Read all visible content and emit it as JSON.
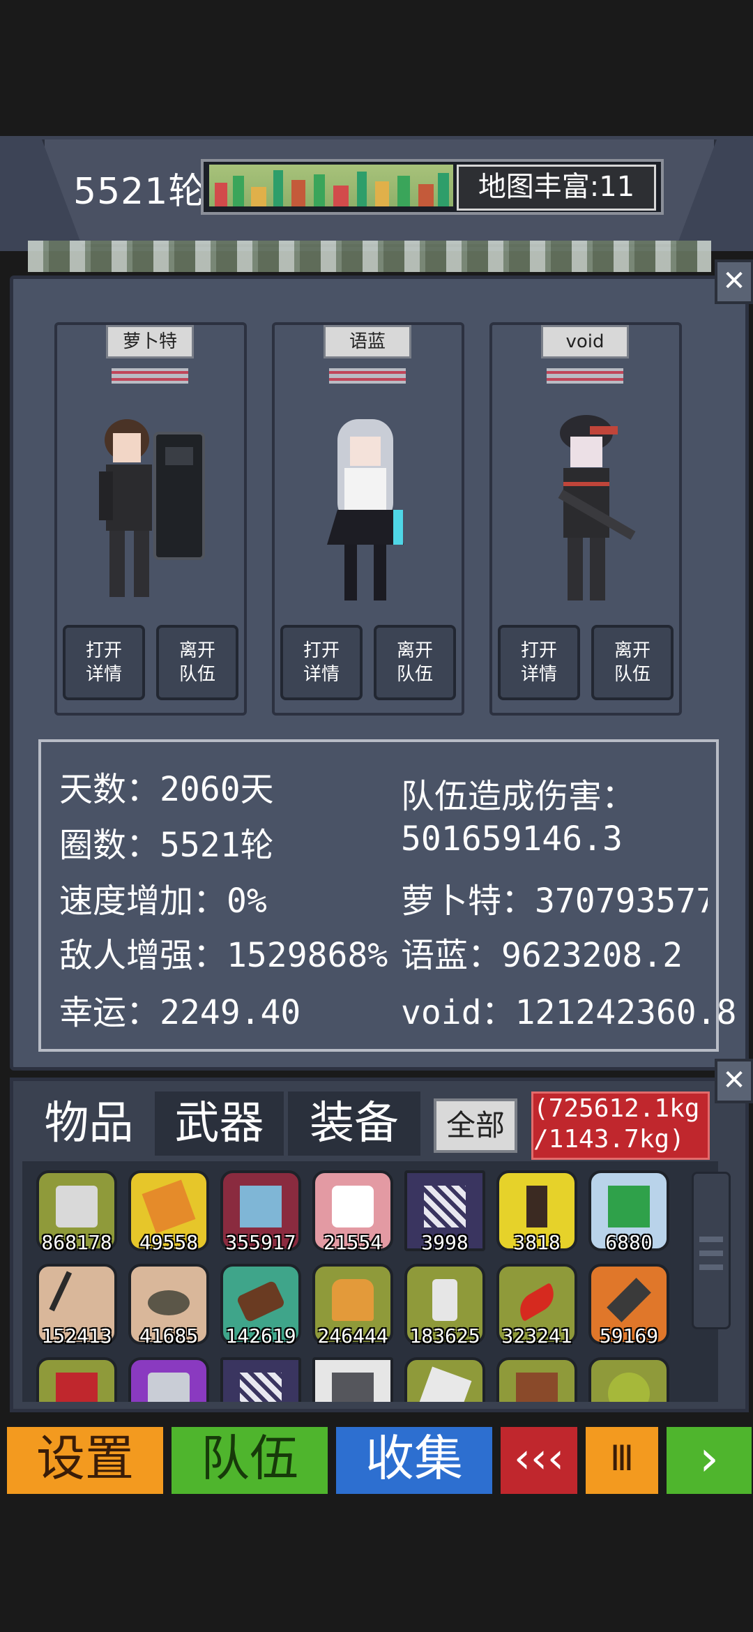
{
  "header": {
    "round": "5521轮",
    "map_richness": "地图丰富:11"
  },
  "team": {
    "members": [
      {
        "name": "萝卜特",
        "detail_btn": "打开\n详情",
        "leave_btn": "离开\n队伍"
      },
      {
        "name": "语蓝",
        "detail_btn": "打开\n详情",
        "leave_btn": "离开\n队伍"
      },
      {
        "name": "void",
        "detail_btn": "打开\n详情",
        "leave_btn": "离开\n队伍"
      }
    ],
    "close_label": "✕"
  },
  "stats": {
    "days": "天数：2060天",
    "loops": "圈数：5521轮",
    "speed": "速度增加：0%",
    "enemy": "敌人增强：1529868%",
    "luck": "幸运：2249.40",
    "damage_title": "队伍造成伤害：",
    "damage_total": "501659146.3",
    "dmg_1": "萝卜特：370793577.",
    "dmg_2": "语蓝：9623208.2",
    "dmg_3": "void：121242360.8"
  },
  "inventory": {
    "tabs": [
      "物品",
      "武器",
      "装备"
    ],
    "all_label": "全部",
    "weight_line1": "(725612.1kg",
    "weight_line2": "/1143.7kg)",
    "close_label": "✕",
    "items_row1": [
      "868178",
      "49558",
      "355917",
      "21554",
      "3998",
      "3818",
      "6880"
    ],
    "items_row2": [
      "152413",
      "41685",
      "142619",
      "246444",
      "183625",
      "323241",
      "59169"
    ],
    "icons_row1": [
      "supplies-icon",
      "map-scroll-icon",
      "shirt-icon",
      "medkit-icon",
      "blueprint-icon",
      "bottle-icon",
      "circuit-board-icon"
    ],
    "icons_row2": [
      "wire-icon",
      "stone-icon",
      "wood-log-icon",
      "bread-icon",
      "jar-icon",
      "chili-icon",
      "bullet-icon"
    ],
    "icons_row3": [
      "meat-icon",
      "can-icon",
      "blueprint-icon",
      "gun-crate-icon",
      "cloth-icon",
      "chocolate-icon",
      "fruit-icon"
    ]
  },
  "nav": {
    "settings": "设置",
    "team": "队伍",
    "collect": "收集",
    "rewind": "‹‹‹",
    "pause": "Ⅲ",
    "forward": "›"
  },
  "colors": {
    "settings_bg": "#f39a1f",
    "team_bg": "#4fb52d",
    "collect_bg": "#2d6fd0",
    "rewind_bg": "#c0272d",
    "pause_bg": "#f39a1f",
    "forward_bg": "#4fb52d"
  }
}
